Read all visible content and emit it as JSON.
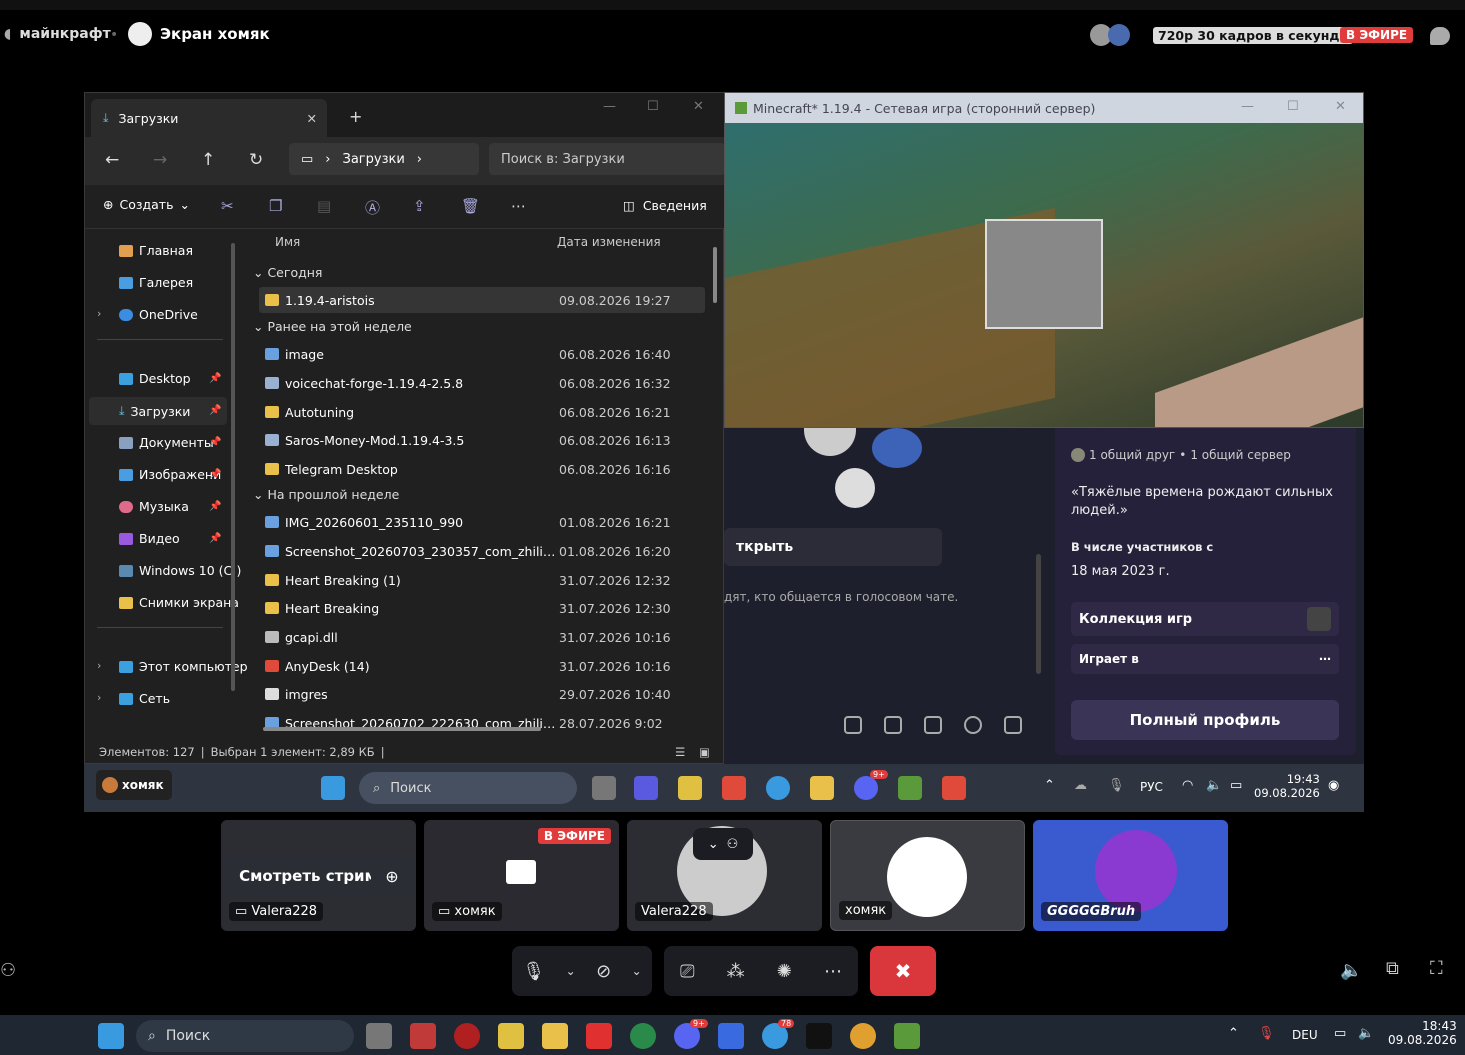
{
  "top": {
    "channel": "майнкрафт",
    "screen_user": "Экран хомяк",
    "quality": "720p 30 кадров в секунду",
    "live": "В ЭФИРЕ"
  },
  "explorer": {
    "tab_title": "Загрузки",
    "address": "Загрузки",
    "search_placeholder": "Поиск в: Загрузки",
    "create_label": "Создать",
    "details_label": "Сведения",
    "sidebar": [
      "Главная",
      "Галерея",
      "OneDrive",
      "Desktop",
      "Загрузки",
      "Документы",
      "Изображени",
      "Музыка",
      "Видео",
      "Windows 10 (C:)",
      "Снимки экрана",
      "Этот компьютер",
      "Сеть"
    ],
    "col_name": "Имя",
    "col_date": "Дата изменения",
    "groups": [
      "Сегодня",
      "Ранее на этой неделе",
      "На прошлой неделе"
    ],
    "files": [
      {
        "name": "1.19.4-aristois",
        "date": "09.08.2026 19:27",
        "color": "#e8c04a"
      },
      {
        "name": "image",
        "date": "06.08.2026 16:40",
        "color": "#6aa0e0"
      },
      {
        "name": "voicechat-forge-1.19.4-2.5.8",
        "date": "06.08.2026 16:32",
        "color": "#9ab0d0"
      },
      {
        "name": "Autotuning",
        "date": "06.08.2026 16:21",
        "color": "#e8c04a"
      },
      {
        "name": "Saros-Money-Mod.1.19.4-3.5",
        "date": "06.08.2026 16:13",
        "color": "#9ab0d0"
      },
      {
        "name": "Telegram Desktop",
        "date": "06.08.2026 16:16",
        "color": "#e8c04a"
      },
      {
        "name": "IMG_20260601_235110_990",
        "date": "01.08.2026 16:21",
        "color": "#6aa0e0"
      },
      {
        "name": "Screenshot_20260703_230357_com_zhiliaoapp_...",
        "date": "01.08.2026 16:20",
        "color": "#6aa0e0"
      },
      {
        "name": "Heart Breaking (1)",
        "date": "31.07.2026 12:32",
        "color": "#e8c04a"
      },
      {
        "name": "Heart Breaking",
        "date": "31.07.2026 12:30",
        "color": "#e8c04a"
      },
      {
        "name": "gcapi.dll",
        "date": "31.07.2026 10:16",
        "color": "#bbbbbb"
      },
      {
        "name": "AnyDesk (14)",
        "date": "31.07.2026 10:16",
        "color": "#e04a3a"
      },
      {
        "name": "imgres",
        "date": "29.07.2026 10:40",
        "color": "#dddddd"
      },
      {
        "name": "Screenshot_20260702_222630_com_zhiliaoapp_...",
        "date": "28.07.2026 9:02",
        "color": "#6aa0e0"
      }
    ],
    "status_count": "Элементов: 127",
    "status_selected": "Выбран 1 элемент: 2,89 КБ"
  },
  "minecraft": {
    "title": "Minecraft* 1.19.4 - Сетевая игра (сторонний сервер)"
  },
  "discord_profile": {
    "mutual": "1 общий друг",
    "servers": "1 общий сервер",
    "quote": "«Тяжёлые времена рождают сильных людей.»",
    "member_since_label": "В числе участников с",
    "member_since": "18 мая 2023 г.",
    "games": "Коллекция игр",
    "playing": "Играет в",
    "full_profile": "Полный профиль"
  },
  "discord_bg": {
    "open_btn": "ткрыть",
    "voice_text": "дят, кто общается в голосовом чате."
  },
  "inner_taskbar": {
    "user": "хомяк",
    "search": "Поиск",
    "lang": "РУС",
    "time": "19:43",
    "date": "09.08.2026",
    "badge": "9+"
  },
  "tiles": {
    "watch": "Смотреть стрим",
    "t1": "Valera228",
    "t2": "хомяк",
    "t2_live": "В ЭФИРЕ",
    "t3": "Valera228",
    "t4": "хомяк",
    "t5": "GGGGGBruh"
  },
  "taskbar": {
    "search": "Поиск",
    "lang": "DEU",
    "time": "18:43",
    "date": "09.08.2026",
    "badge1": "9+",
    "badge2": "78"
  }
}
